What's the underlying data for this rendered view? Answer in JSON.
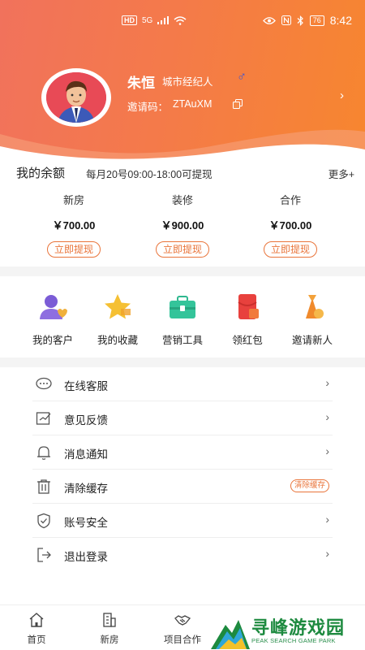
{
  "status_bar": {
    "network": "HD",
    "signal": "5G",
    "time": "8:42",
    "battery": "76"
  },
  "profile": {
    "name": "朱恒",
    "role": "城市经纪人",
    "gender_symbol": "♂",
    "invite_label": "邀请码：",
    "invite_code": "ZTAuXM",
    "arrow": "›"
  },
  "balance": {
    "title": "我的余额",
    "note": "每月20号09:00-18:00可提现",
    "more": "更多+",
    "items": [
      {
        "label": "新房",
        "amount": "￥700.00",
        "button": "立即提现"
      },
      {
        "label": "装修",
        "amount": "￥900.00",
        "button": "立即提现"
      },
      {
        "label": "合作",
        "amount": "￥700.00",
        "button": "立即提现"
      }
    ]
  },
  "tools": [
    {
      "label": "我的客户",
      "icon": "customers-icon"
    },
    {
      "label": "我的收藏",
      "icon": "star-icon"
    },
    {
      "label": "营销工具",
      "icon": "toolbox-icon"
    },
    {
      "label": "领红包",
      "icon": "red-envelope-icon"
    },
    {
      "label": "邀请新人",
      "icon": "invite-icon"
    }
  ],
  "menu": [
    {
      "label": "在线客服",
      "icon": "chat-icon",
      "arrow": "›"
    },
    {
      "label": "意见反馈",
      "icon": "feedback-icon",
      "arrow": "›"
    },
    {
      "label": "消息通知",
      "icon": "bell-icon",
      "arrow": "›"
    },
    {
      "label": "清除缓存",
      "icon": "trash-icon",
      "badge": "清除缓存"
    },
    {
      "label": "账号安全",
      "icon": "shield-icon",
      "arrow": "›"
    },
    {
      "label": "退出登录",
      "icon": "logout-icon",
      "arrow": "›"
    }
  ],
  "tabs": [
    {
      "label": "首页",
      "icon": "home-icon"
    },
    {
      "label": "新房",
      "icon": "building-icon"
    },
    {
      "label": "项目合作",
      "icon": "handshake-icon"
    }
  ],
  "watermark": {
    "title": "寻峰游戏园",
    "subtitle": "PEAK SEARCH GAME PARK"
  },
  "colors": {
    "accent": "#f47a4a",
    "button": "#e9743a",
    "gender": "#3a55d8"
  }
}
